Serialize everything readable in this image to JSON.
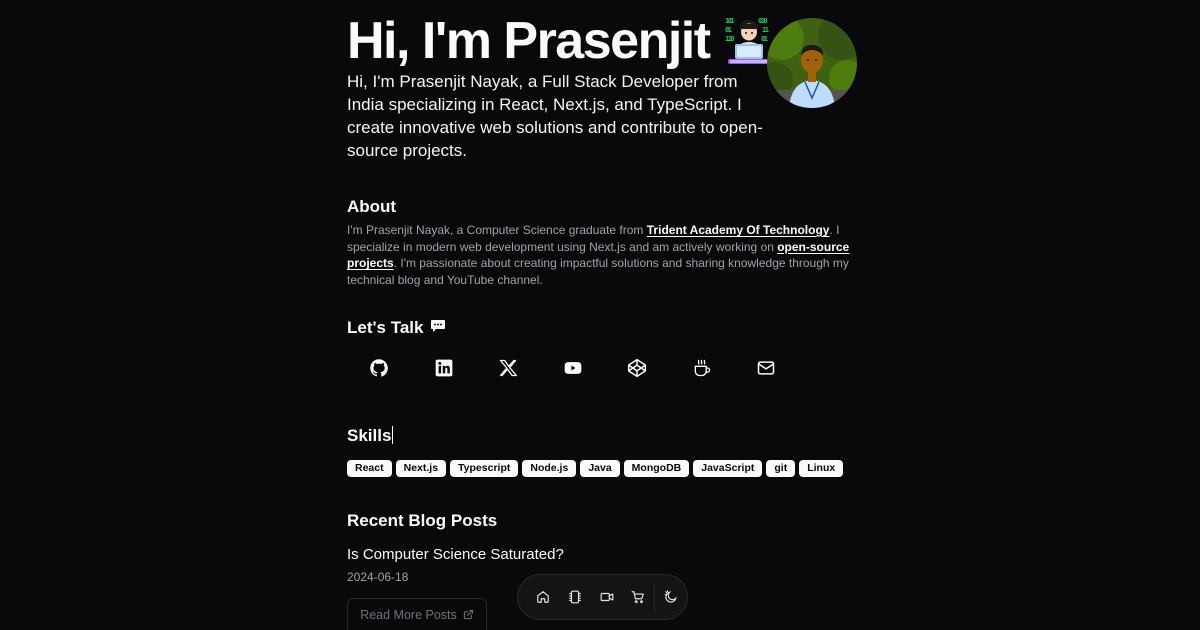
{
  "hero": {
    "title": "Hi, I'm Prasenjit",
    "emoji_icon": "technologist-emoji",
    "subtitle": "Hi, I'm Prasenjit Nayak, a Full Stack Developer from India specializing in React, Next.js, and TypeScript. I create innovative web solutions and contribute to open-source projects."
  },
  "about": {
    "heading": "About",
    "text_1": "I'm Prasenjit Nayak, a Computer Science graduate from ",
    "link_1": "Trident Academy Of Technology",
    "text_2": ". I specialize in modern web development using Next.js and am actively working on ",
    "link_2": "open-source projects",
    "text_3": ". I'm passionate about creating impactful solutions and sharing knowledge through my technical blog and YouTube channel."
  },
  "talk": {
    "heading": "Let's Talk",
    "socials": [
      {
        "icon": "github-icon"
      },
      {
        "icon": "linkedin-icon"
      },
      {
        "icon": "x-icon"
      },
      {
        "icon": "youtube-icon"
      },
      {
        "icon": "codepen-icon"
      },
      {
        "icon": "coffee-icon"
      },
      {
        "icon": "mail-icon"
      }
    ]
  },
  "skills": {
    "heading": "Skills",
    "items": [
      "React",
      "Next.js",
      "Typescript",
      "Node.js",
      "Java",
      "MongoDB",
      "JavaScript",
      "git",
      "Linux"
    ]
  },
  "blog": {
    "heading": "Recent Blog Posts",
    "posts": [
      {
        "title": "Is Computer Science Saturated?",
        "date": "2024-06-18"
      }
    ],
    "read_more": "Read More Posts"
  },
  "dock": {
    "items": [
      "home-icon",
      "notebook-icon",
      "video-icon",
      "cart-icon",
      "theme-toggle-icon"
    ]
  },
  "colors": {
    "background": "#09090b",
    "text": "#fafafa",
    "muted": "#a1a1aa",
    "badge_bg": "#fafafa",
    "badge_text": "#09090b"
  }
}
